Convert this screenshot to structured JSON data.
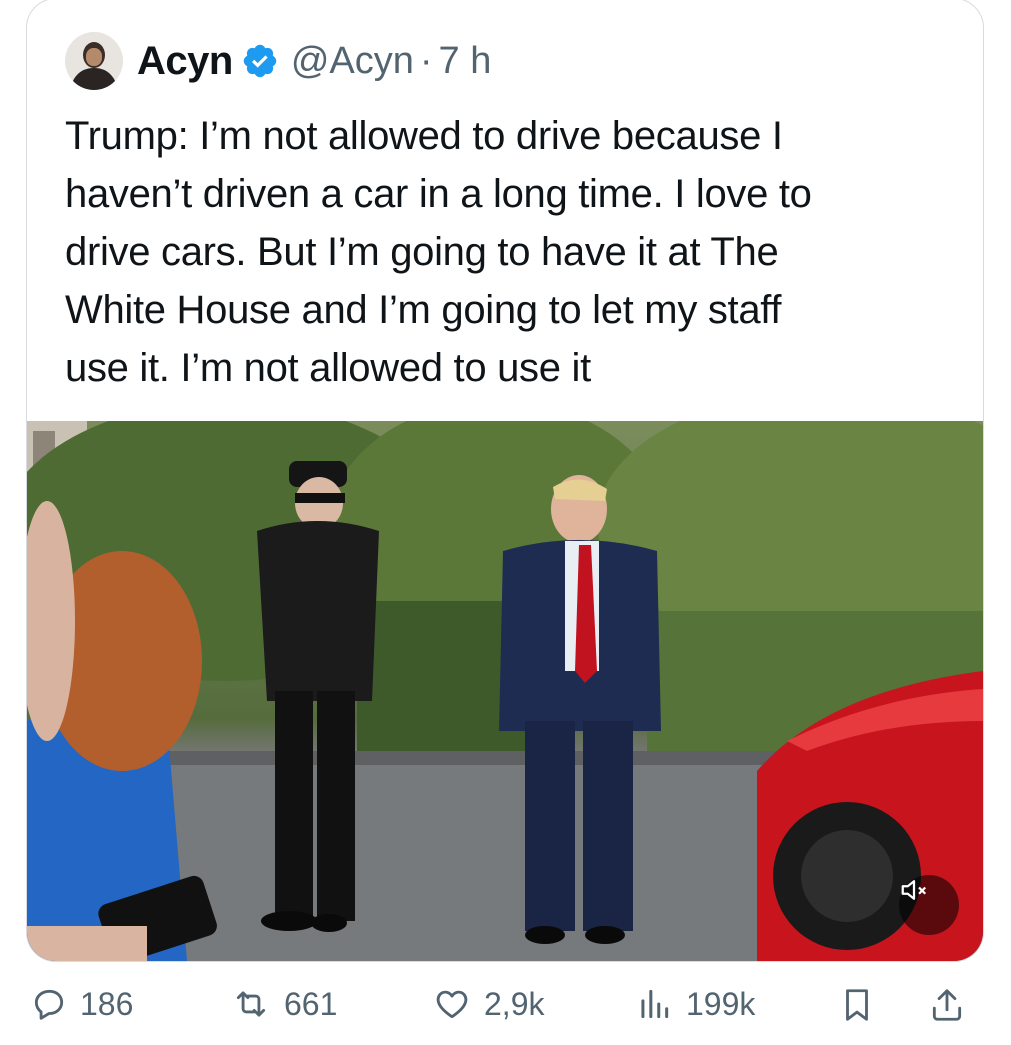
{
  "tweet": {
    "author_name": "Acyn",
    "author_handle": "@Acyn",
    "time_sep": "·",
    "time": "7 h",
    "text": "Trump: I’m not allowed to drive because I\nhaven’t driven a car in a long time. I love to\ndrive cars. But I’m going to have it at The\nWhite House and I’m going to let my staff\nuse it. I’m not allowed to use it"
  },
  "media": {
    "type": "video",
    "muted_icon": "speaker-muted-icon"
  },
  "actions": {
    "replies": "186",
    "reposts": "661",
    "likes": "2,9k",
    "views": "199k"
  },
  "colors": {
    "verified": "#1d9bf0",
    "secondary_text": "#536471",
    "border": "#d7dbdf"
  }
}
